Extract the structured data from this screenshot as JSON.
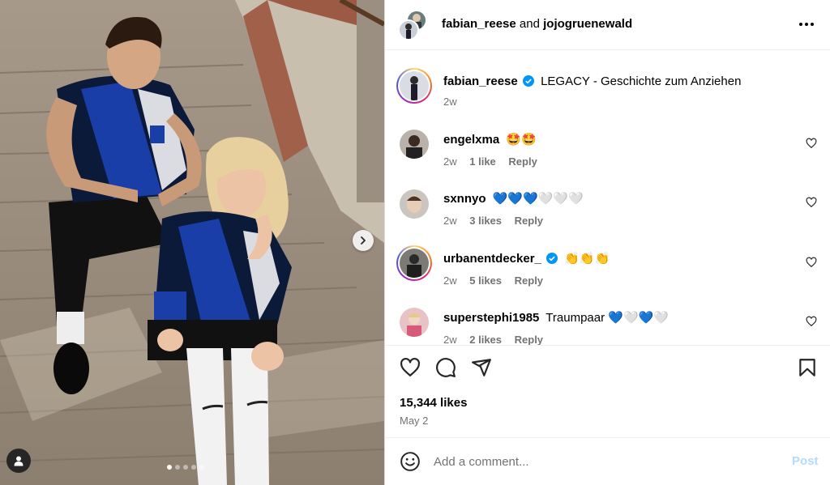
{
  "header": {
    "user1": "fabian_reese",
    "and": "and",
    "user2": "jojogruenewald"
  },
  "caption": {
    "user": "fabian_reese",
    "verified": true,
    "text": "LEGACY - Geschichte zum Anziehen",
    "time": "2w"
  },
  "comments": [
    {
      "user": "engelxma",
      "text": "🤩🤩",
      "time": "2w",
      "likes": "1 like",
      "reply": "Reply",
      "story_ring": false,
      "verified": false
    },
    {
      "user": "sxnnyo",
      "text": "💙💙💙🤍🤍🤍",
      "time": "2w",
      "likes": "3 likes",
      "reply": "Reply",
      "story_ring": false,
      "verified": false
    },
    {
      "user": "urbanentdecker_",
      "text": "👏👏👏",
      "time": "2w",
      "likes": "5 likes",
      "reply": "Reply",
      "story_ring": true,
      "verified": true
    },
    {
      "user": "superstephi1985",
      "text": "Traumpaar 💙🤍💙🤍",
      "time": "2w",
      "likes": "2 likes",
      "reply": "Reply",
      "story_ring": false,
      "verified": false
    }
  ],
  "stats": {
    "likes": "15,344 likes",
    "date": "May 2"
  },
  "add_comment": {
    "placeholder": "Add a comment...",
    "post_label": "Post"
  },
  "carousel": {
    "slide_count": 5,
    "active_slide": 1
  },
  "colors": {
    "link_disabled": "#b3dbff",
    "verified_blue": "#0095f6",
    "meta_gray": "#737373",
    "kit_blue": "#1a3ea8",
    "kit_navy": "#0c1a3a"
  },
  "icons": [
    "chevron-right-icon",
    "user-tag-icon",
    "more-icon",
    "heart-icon",
    "comment-icon",
    "share-icon",
    "bookmark-icon",
    "emoji-icon",
    "verified-icon"
  ]
}
